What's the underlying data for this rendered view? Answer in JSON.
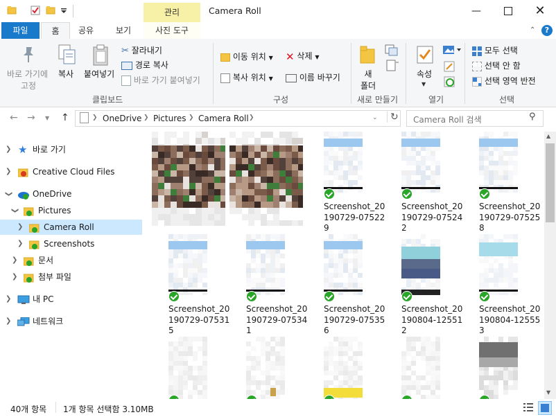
{
  "window": {
    "title": "Camera Roll",
    "contextual_tab": "관리",
    "minimize_icon": "minimize-icon",
    "maximize_icon": "maximize-icon",
    "close_icon": "close-icon"
  },
  "ribbon_tabs": {
    "file": "파일",
    "home": "홈",
    "share": "공유",
    "view": "보기",
    "picture_tools": "사진 도구"
  },
  "ribbon": {
    "clipboard": {
      "label": "클립보드",
      "pin": "바로 가기에",
      "pin2": "고정",
      "copy": "복사",
      "paste": "붙여넣기",
      "cut": "잘라내기",
      "copy_path": "경로 복사",
      "paste_shortcut": "바로 가기 붙여넣기"
    },
    "organize": {
      "label": "구성",
      "move_to": "이동 위치",
      "copy_to": "복사 위치",
      "delete": "삭제",
      "rename": "이름 바꾸기"
    },
    "new": {
      "label": "새로 만들기",
      "new_folder": "새",
      "new_folder2": "폴더"
    },
    "open": {
      "label": "열기",
      "properties": "속성"
    },
    "select": {
      "label": "선택",
      "select_all": "모두 선택",
      "select_none": "선택 안 함",
      "invert": "선택 영역 반전"
    }
  },
  "address": {
    "crumbs": [
      "OneDrive",
      "Pictures",
      "Camera Roll"
    ],
    "search_placeholder": "Camera Roll 검색"
  },
  "nav": {
    "quick_access": "바로 가기",
    "creative_cloud": "Creative Cloud Files",
    "onedrive": "OneDrive",
    "pictures": "Pictures",
    "camera_roll": "Camera Roll",
    "screenshots": "Screenshots",
    "documents": "문서",
    "attachments": "첨부 파일",
    "this_pc": "내 PC",
    "network": "네트워크"
  },
  "files": [
    {
      "name": "",
      "kind": "photo"
    },
    {
      "name": "",
      "kind": "photo"
    },
    {
      "name": "Screenshot_20190729-075229",
      "kind": "shot"
    },
    {
      "name": "Screenshot_20190729-075242",
      "kind": "shot"
    },
    {
      "name": "Screenshot_20190729-075258",
      "kind": "shot"
    },
    {
      "name": "Screenshot_20190729-075315",
      "kind": "shot"
    },
    {
      "name": "Screenshot_20190729-075341",
      "kind": "shot"
    },
    {
      "name": "Screenshot_20190729-075356",
      "kind": "shot"
    },
    {
      "name": "Screenshot_20190804-125512",
      "kind": "shot2"
    },
    {
      "name": "Screenshot_20190804-125553",
      "kind": "shot3"
    },
    {
      "name": "",
      "kind": "plain"
    },
    {
      "name": "",
      "kind": "plain"
    },
    {
      "name": "",
      "kind": "plain"
    },
    {
      "name": "",
      "kind": "plain"
    },
    {
      "name": "",
      "kind": "gray"
    }
  ],
  "status": {
    "count": "40개 항목",
    "selection": "1개 항목 선택함 3.10MB"
  },
  "colors": {
    "accent": "#1979ca",
    "selected": "#cce8ff",
    "context_tab": "#f7f1a8",
    "synced": "#2aa52a"
  }
}
